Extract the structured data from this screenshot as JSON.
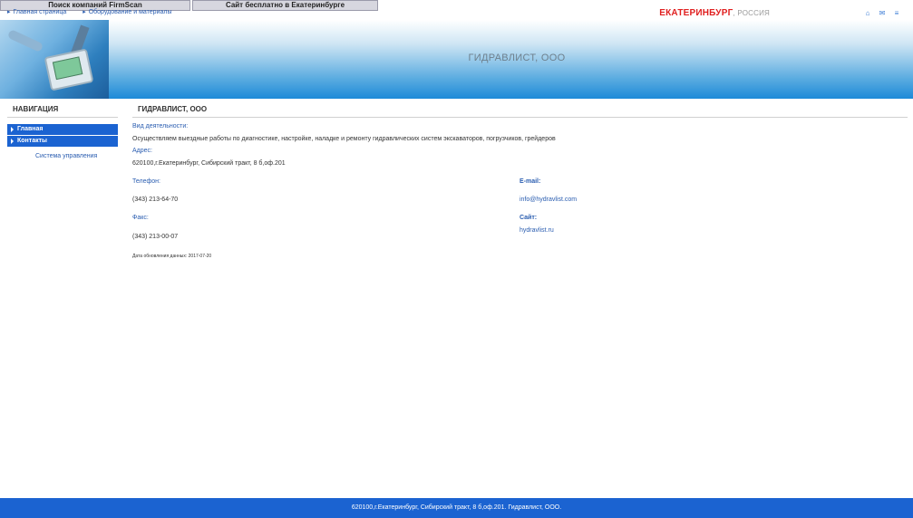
{
  "top_bar": {
    "search_button": "Поиск компаний FirmScan",
    "free_site_button": "Сайт бесплатно в Екатеринбурге"
  },
  "breadcrumbs": [
    "Главная страница",
    "Оборудование и материалы"
  ],
  "city": {
    "name": "ЕКАТЕРИНБУРГ",
    "country": ", РОССИЯ"
  },
  "icons": [
    "home-icon",
    "mail-icon",
    "sitemap-icon"
  ],
  "banner": {
    "title": "ГИДРАВЛИСТ, ООО"
  },
  "sidebar": {
    "title": "НАВИГАЦИЯ",
    "items": [
      {
        "label": "Главная"
      },
      {
        "label": "Контакты"
      }
    ],
    "system_link": "Система управления"
  },
  "main": {
    "title": "ГИДРАВЛИСТ, ООО",
    "activity_label": "Вид деятельности:",
    "activity_text": "Осуществляем выездные работы по диагностике, настройке, наладке и ремонту гидравлических систем экскаваторов, погрузчиков, грейдеров",
    "address_label": "Адрес:",
    "address_text": "620100,г.Екатеринбург, Сибирский тракт, 8 б,оф.201",
    "phone_label": "Телефон:",
    "phone_value": "(343) 213-64-70",
    "fax_label": "Факс:",
    "fax_value": "(343) 213-00-07",
    "email_label": "E-mail:",
    "email_value": "info@hydravlist.com",
    "site_label": "Сайт:",
    "site_value": "hydravlist.ru",
    "updated_text": "Дата обновления данных: 2017-07-20"
  },
  "footer": {
    "text": "620100,г.Екатеринбург, Сибирский тракт, 8 б,оф.201. Гидравлист, ООО."
  },
  "colors": {
    "nav_blue": "#1b63d1",
    "link_blue": "#2a5db0",
    "city_red": "#e02020",
    "footer_blue": "#1b63d1"
  }
}
